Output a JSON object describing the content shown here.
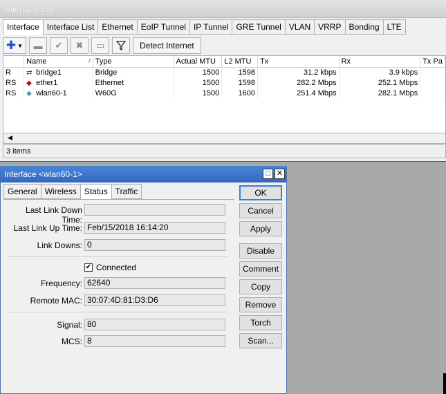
{
  "list_window": {
    "title": "Interface List",
    "tabs": [
      "Interface",
      "Interface List",
      "Ethernet",
      "EoIP Tunnel",
      "IP Tunnel",
      "GRE Tunnel",
      "VLAN",
      "VRRP",
      "Bonding",
      "LTE"
    ],
    "active_tab": "Interface",
    "toolbar": {
      "detect_internet": "Detect Internet"
    },
    "columns": [
      "",
      "Name",
      "Type",
      "Actual MTU",
      "L2 MTU",
      "Tx",
      "Rx",
      "Tx Pa"
    ],
    "sort_indicator": "/",
    "rows": [
      {
        "flags": "R",
        "name": "bridge1",
        "type": "Bridge",
        "actual_mtu": "1500",
        "l2_mtu": "1598",
        "tx": "31.2 kbps",
        "rx": "3.9 kbps",
        "icon": "bridge-icon"
      },
      {
        "flags": "RS",
        "name": "ether1",
        "type": "Ethernet",
        "actual_mtu": "1500",
        "l2_mtu": "1598",
        "tx": "282.2 Mbps",
        "rx": "252.1 Mbps",
        "icon": "ethernet-icon"
      },
      {
        "flags": "RS",
        "name": "wlan60-1",
        "type": "W60G",
        "actual_mtu": "1500",
        "l2_mtu": "1600",
        "tx": "251.4 Mbps",
        "rx": "282.1 Mbps",
        "icon": "wireless-icon"
      }
    ],
    "status": "3 items"
  },
  "dialog": {
    "title": "Interface <wlan60-1>",
    "tabs": [
      "General",
      "Wireless",
      "Status",
      "Traffic"
    ],
    "active_tab": "Status",
    "fields": {
      "last_link_down_label": "Last Link Down Time:",
      "last_link_down_value": "",
      "last_link_up_label": "Last Link Up Time:",
      "last_link_up_value": "Feb/15/2018 16:14:20",
      "link_downs_label": "Link Downs:",
      "link_downs_value": "0",
      "connected_label": "Connected",
      "connected_checked": true,
      "frequency_label": "Frequency:",
      "frequency_value": "62640",
      "remote_mac_label": "Remote MAC:",
      "remote_mac_value": "30:07:4D:81:D3:D6",
      "signal_label": "Signal:",
      "signal_value": "80",
      "mcs_label": "MCS:",
      "mcs_value": "8"
    },
    "buttons": {
      "ok": "OK",
      "cancel": "Cancel",
      "apply": "Apply",
      "disable": "Disable",
      "comment": "Comment",
      "copy": "Copy",
      "remove": "Remove",
      "torch": "Torch",
      "scan": "Scan..."
    }
  },
  "colors": {
    "dialog_title": "#3a73c8",
    "ok_border": "#3c7fd1",
    "ethernet_icon": "#c00000",
    "wireless_icon": "#1b6ea8"
  }
}
